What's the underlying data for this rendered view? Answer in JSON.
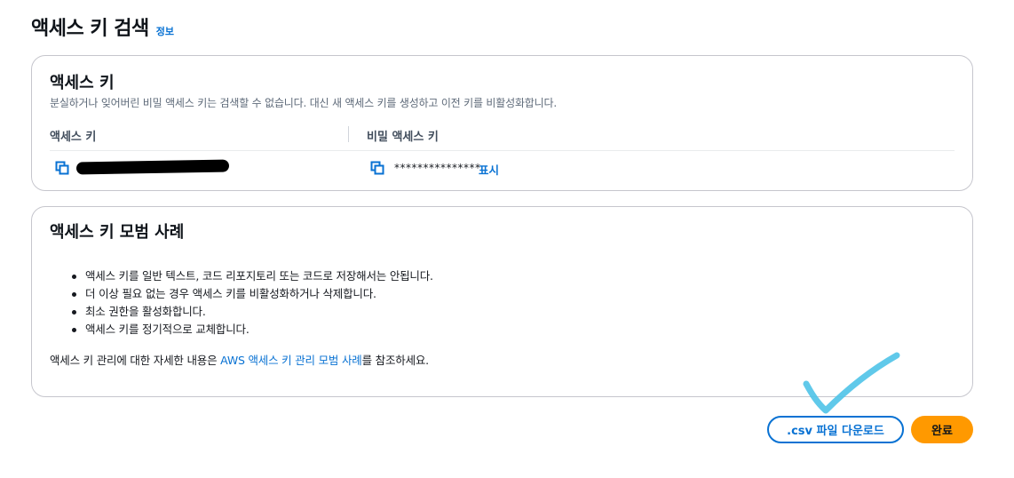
{
  "header": {
    "title": "액세스 키 검색",
    "info_link": "정보"
  },
  "access_key_card": {
    "title": "액세스 키",
    "description": "분실하거나 잊어버린 비밀 액세스 키는 검색할 수 없습니다. 대신 새 액세스 키를 생성하고 이전 키를 비활성화합니다.",
    "col_access_key": "액세스 키",
    "col_secret_key": "비밀 액세스 키",
    "secret_value": "***************",
    "show_link": "표시"
  },
  "best_practices_card": {
    "title": "액세스 키 모범 사례",
    "items": [
      "액세스 키를 일반 텍스트, 코드 리포지토리 또는 코드로 저장해서는 안됩니다.",
      "더 이상 필요 없는 경우 액세스 키를 비활성화하거나 삭제합니다.",
      "최소 권한을 활성화합니다.",
      "액세스 키를 정기적으로 교체합니다."
    ],
    "footer_prefix": "액세스 키 관리에 대한 자세한 내용은 ",
    "footer_link": "AWS 액세스 키 관리 모범 사례",
    "footer_suffix": "를 참조하세요."
  },
  "actions": {
    "download_csv": ".csv 파일 다운로드",
    "done": "완료"
  },
  "colors": {
    "link_blue": "#0972d3",
    "primary_orange": "#ff9900",
    "checkmark_annotation": "#4fc3e8"
  },
  "icons": [
    "copy-icon",
    "checkmark-annotation"
  ]
}
